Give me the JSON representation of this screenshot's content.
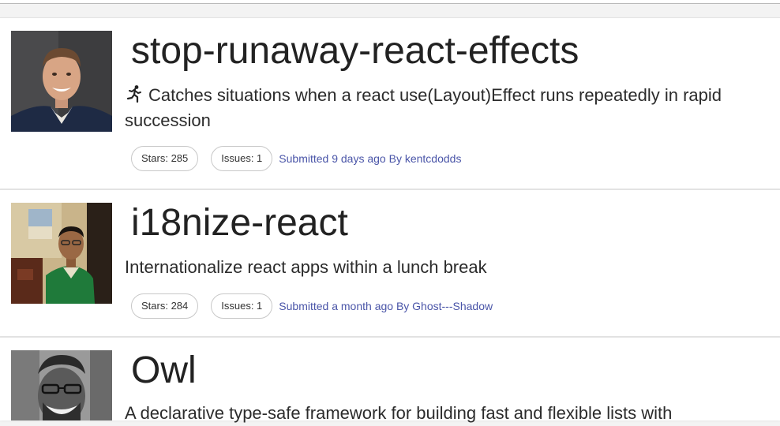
{
  "items": [
    {
      "title": "stop-runaway-react-effects",
      "description": "Catches situations when a react use(Layout)Effect runs repeatedly in rapid succession",
      "description_icon": "runner-icon",
      "stars_label": "Stars: 285",
      "issues_label": "Issues: 1",
      "submitted": "Submitted 9 days ago By kentcdodds"
    },
    {
      "title": "i18nize-react",
      "description": "Internationalize react apps within a lunch break",
      "stars_label": "Stars: 284",
      "issues_label": "Issues: 1",
      "submitted": "Submitted a month ago By Ghost---Shadow"
    },
    {
      "title": "Owl",
      "description": "A declarative type-safe framework for building fast and flexible lists with"
    }
  ],
  "colors": {
    "link": "#4a55a8",
    "pill_border": "#c8c8c8",
    "page_bg": "#f3f3f3"
  }
}
